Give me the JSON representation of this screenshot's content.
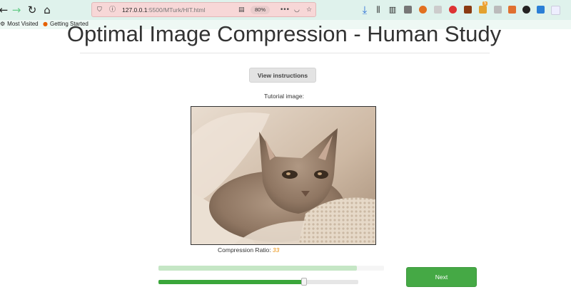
{
  "browser": {
    "url_host": "127.0.0.1",
    "url_path": ":5500/MTurk/HIT.html",
    "zoom": "80%",
    "bookmarks": [
      "Most Visited",
      "Getting Started"
    ],
    "extension_badge": "5"
  },
  "page": {
    "title": "Optimal Image Compression - Human Study",
    "instructions_button": "View instructions",
    "tutorial_label": "Tutorial image:",
    "ratio_label": "Compression Ratio:",
    "ratio_value": "33",
    "next_button": "Next",
    "progress_fraction": 0.88,
    "slider_fraction": 0.73
  },
  "colors": {
    "accent_green": "#45a945",
    "ratio_orange": "#f0ad4e",
    "progress_light_green": "#c5e6c5"
  }
}
